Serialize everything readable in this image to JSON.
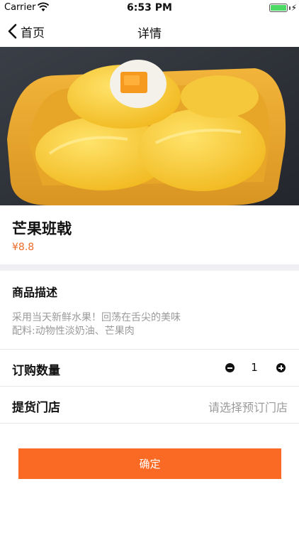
{
  "status_bar": {
    "carrier": "Carrier",
    "time": "6:53 PM",
    "battery_color": "#4cd964"
  },
  "nav": {
    "back_label": "首页",
    "title": "详情"
  },
  "product": {
    "name": "芒果班戟",
    "price": "¥8.8",
    "image_subject": "mango crepe rolls in yellow bowl"
  },
  "description": {
    "title": "商品描述",
    "line1": "采用当天新鲜水果！回荡在舌尖的美味",
    "line2": "配料:动物性淡奶油、芒果肉"
  },
  "quantity": {
    "label": "订购数量",
    "value": "1"
  },
  "store": {
    "label": "提货门店",
    "placeholder": "请选择预订门店"
  },
  "actions": {
    "confirm_label": "确定",
    "accent_color": "#fb6a24"
  }
}
